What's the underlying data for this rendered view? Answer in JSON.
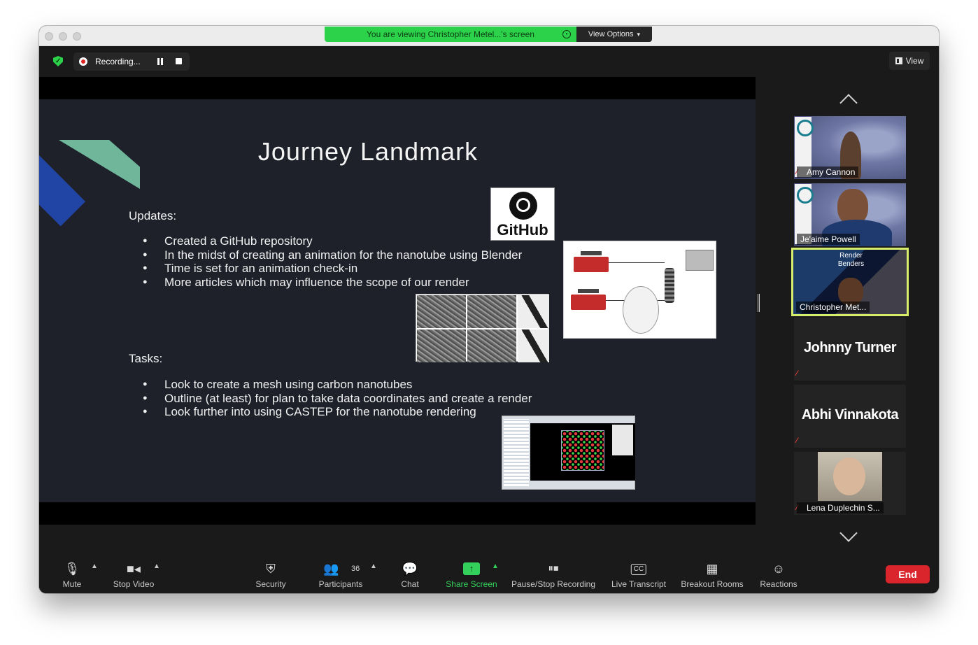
{
  "banner": {
    "text": "You are viewing Christopher Metel...'s screen",
    "options_label": "View Options"
  },
  "recording": {
    "label": "Recording..."
  },
  "view_button": {
    "label": "View"
  },
  "slide": {
    "title": "Journey Landmark",
    "updates_heading": "Updates:",
    "updates": [
      "Created a GitHub repository",
      "In the midst of creating an animation for the nanotube using Blender",
      "Time is set for an animation check-in",
      "More articles which may influence the scope of our render"
    ],
    "tasks_heading": "Tasks:",
    "tasks": [
      "Look to create a mesh using carbon nanotubes",
      "Outline (at least) for plan to take data coordinates and create a render",
      "Look further into using CASTEP for the nanotube rendering"
    ],
    "github_logo_text": "GitHub"
  },
  "participants_panel": [
    {
      "name": "Amy Cannon",
      "muted": true
    },
    {
      "name": "Je'aime Powell",
      "muted": false
    },
    {
      "name": "Christopher Met...",
      "muted": false,
      "active_speaker": true,
      "background_text": "Render Benders"
    },
    {
      "name": "Johnny Turner",
      "muted": true,
      "video": false
    },
    {
      "name": "Abhi Vinnakota",
      "muted": true,
      "video": false
    },
    {
      "name": "Lena Duplechin S...",
      "muted": true
    }
  ],
  "toolbar": {
    "mute": "Mute",
    "stop_video": "Stop Video",
    "security": "Security",
    "participants": "Participants",
    "participant_count": "36",
    "chat": "Chat",
    "share_screen": "Share Screen",
    "pause_stop_recording": "Pause/Stop Recording",
    "live_transcript": "Live Transcript",
    "live_transcript_icon_text": "CC",
    "breakout_rooms": "Breakout Rooms",
    "reactions": "Reactions",
    "end": "End"
  },
  "colors": {
    "share_green": "#2bd24a",
    "end_red": "#d9252b",
    "active_speaker": "#d6ee6c",
    "slide_bg": "#1e212a"
  }
}
